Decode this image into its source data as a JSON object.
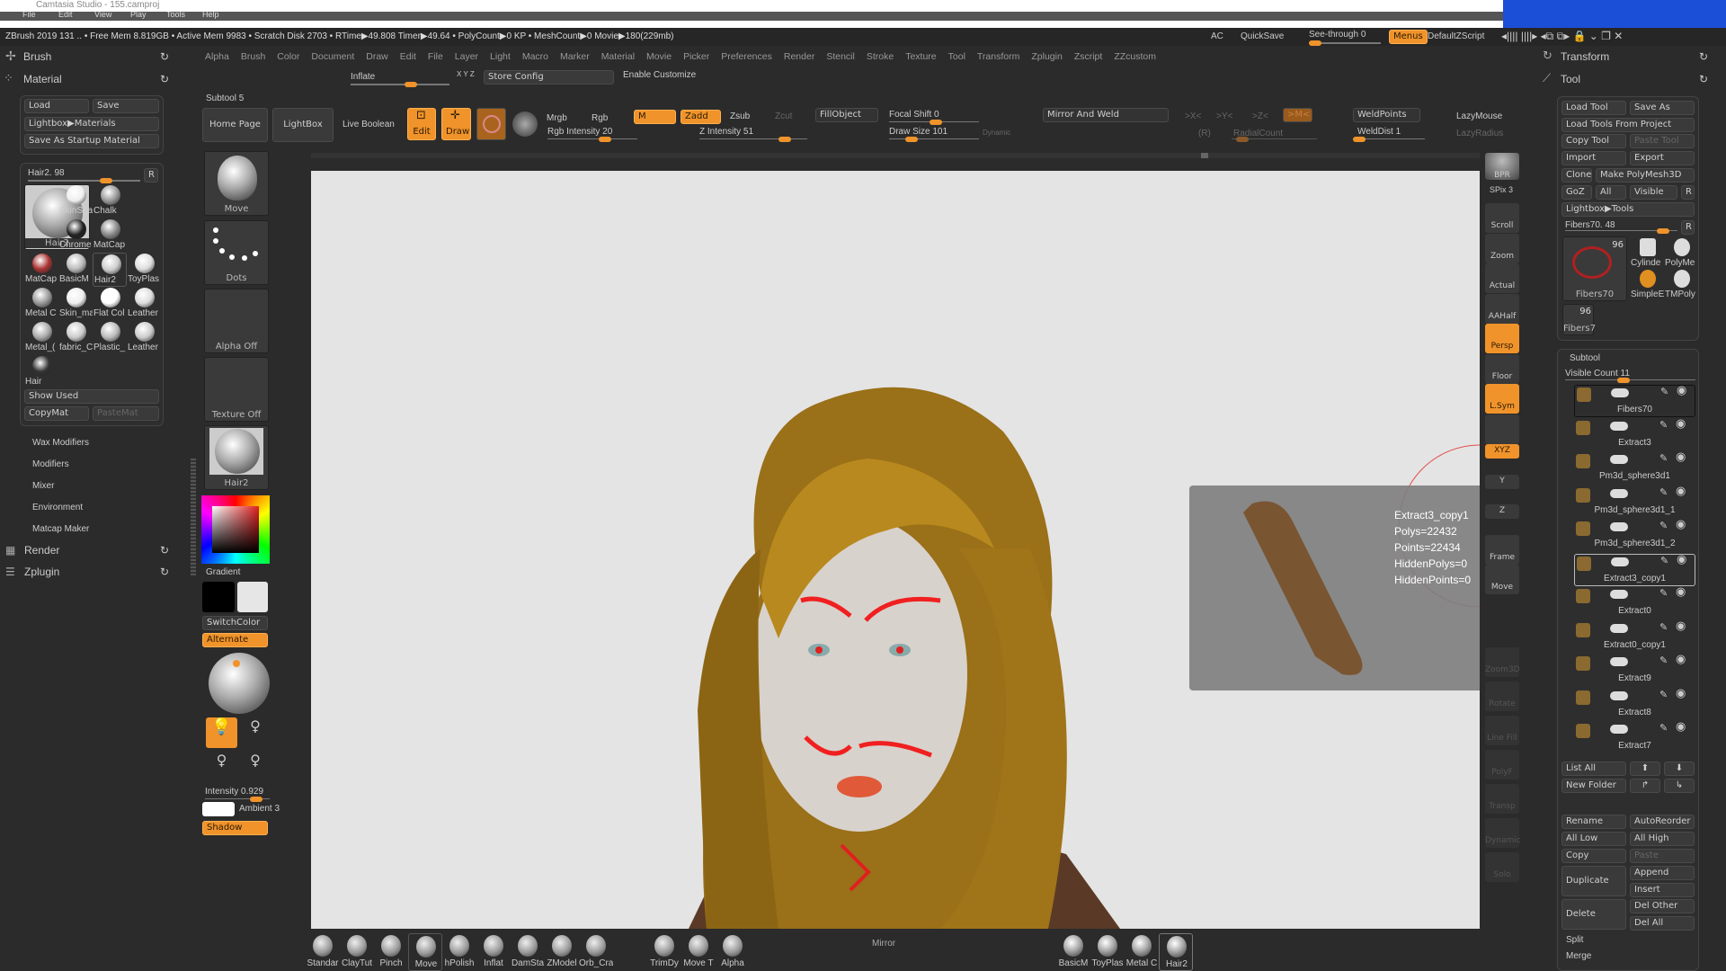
{
  "host": {
    "title": "Camtasia Studio - 155.camproj",
    "menu": [
      "File",
      "Edit",
      "View",
      "Play",
      "Tools",
      "Help"
    ]
  },
  "titlebar": {
    "status": "ZBrush 2019    131   .. • Free Mem 8.819GB • Active Mem 9983 • Scratch Disk 2703 •  RTime▶49.808 Timer▶49.64 • PolyCount▶0 KP  • MeshCount▶0  Movie▶180(229mb)",
    "ac": "AC",
    "quicksave": "QuickSave",
    "see_through": "See-through  0",
    "menus": "Menus",
    "script": "DefaultZScript"
  },
  "menubar": [
    "Alpha",
    "Brush",
    "Color",
    "Document",
    "Draw",
    "Edit",
    "File",
    "Layer",
    "Light",
    "Macro",
    "Marker",
    "Material",
    "Movie",
    "Picker",
    "Preferences",
    "Render",
    "Stencil",
    "Stroke",
    "Texture",
    "Tool",
    "Transform",
    "Zplugin",
    "Zscript",
    "ZZcustom"
  ],
  "custom": {
    "inflate": "Inflate",
    "xyz": "X Y Z",
    "store_config": "Store Config",
    "enable_customize": "Enable Customize"
  },
  "left": {
    "brush": "Brush",
    "material": "Material",
    "load": "Load",
    "save": "Save",
    "lightbox_materials": "Lightbox▶Materials",
    "save_startup": "Save As Startup Material",
    "slider": "Hair2. 98",
    "r": "R",
    "big": "Hair2",
    "materials": [
      "SkinSha",
      "Chalk",
      "Chrome",
      "MatCap",
      "MatCap",
      "BasicM",
      "Hair2",
      "ToyPlas",
      "Metal C",
      "Skin_ma",
      "Flat Col",
      "Leather",
      "Metal_(",
      "fabric_C",
      "Plastic_",
      "Leather",
      "Hair"
    ],
    "show_used": "Show Used",
    "copymat": "CopyMat",
    "pastemat": "PasteMat",
    "submenus": [
      "Wax Modifiers",
      "Modifiers",
      "Mixer",
      "Environment",
      "Matcap Maker"
    ],
    "render": "Render",
    "zplugin": "Zplugin"
  },
  "shelf_left": {
    "move": "Move",
    "dots": "Dots",
    "alpha": "Alpha Off",
    "texture": "Texture Off",
    "material": "Hair2",
    "gradient": "Gradient",
    "switchcolor": "SwitchColor",
    "alternate": "Alternate",
    "intensity": "Intensity 0.929",
    "ambient": "Ambient 3",
    "shadow": "Shadow",
    "main_color": "#000000",
    "secondary_color": "#e6e6e6"
  },
  "toolbar": {
    "subtool": "Subtool 5",
    "home": "Home Page",
    "lightbox": "LightBox",
    "live_boolean": "Live Boolean",
    "edit": "Edit",
    "draw": "Draw",
    "mrgb": "Mrgb",
    "rgb": "Rgb",
    "m": "M",
    "zadd": "Zadd",
    "zsub": "Zsub",
    "zcut": "Zcut",
    "rgb_intensity": "Rgb Intensity 20",
    "z_intensity": "Z Intensity 51",
    "fillobject": "FillObject",
    "focal_shift": "Focal Shift 0",
    "draw_size": "Draw Size 101",
    "dynamic": "Dynamic",
    "mirror_weld": "Mirror And Weld",
    "x": ">X<",
    "y": ">Y<",
    "z": ">Z<",
    "m2": ">M<",
    "r": "(R)",
    "radialcount": "RadialCount",
    "weldpoints": "WeldPoints",
    "welddist": "WeldDist 1",
    "lazymouse": "LazyMouse",
    "lazyradius": "LazyRadius"
  },
  "shelf_right": {
    "bpr": "BPR",
    "spix": "SPix 3",
    "items": [
      "Scroll",
      "Zoom",
      "Actual",
      "AAHalf",
      "Persp",
      "Floor",
      "L.Sym",
      "",
      "XYZ",
      "Y",
      "Z",
      "Frame",
      "Move",
      "Zoom3D",
      "Rotate",
      "Line Fill",
      "PolyF",
      "Transp",
      "Dynamic",
      "Solo"
    ],
    "active": [
      "Persp",
      "L.Sym",
      "XYZ"
    ]
  },
  "info": {
    "name": "Extract3_copy1",
    "polys": "Polys=22432",
    "points": "Points=22434",
    "hidden_polys": "HiddenPolys=0",
    "hidden_points": "HiddenPoints=0"
  },
  "right": {
    "transform": "Transform",
    "tool": "Tool",
    "load_tool": "Load Tool",
    "save_as": "Save As",
    "load_project": "Load Tools From Project",
    "copy_tool": "Copy Tool",
    "paste_tool": "Paste Tool",
    "import": "Import",
    "export": "Export",
    "clone": "Clone",
    "make_polymesh": "Make PolyMesh3D",
    "goz": "GoZ",
    "all": "All",
    "visible": "Visible",
    "r": "R",
    "lightbox_tools": "Lightbox▶Tools",
    "slider": "Fibers70. 48",
    "big": "Fibers70",
    "big_count": "96",
    "tools": [
      "Cylinde",
      "PolyMe",
      "SimpleE",
      "TMPoly"
    ],
    "small": "Fibers7",
    "small_count": "96",
    "subtool": "Subtool",
    "visible_count": "Visible Count 11",
    "subtools": [
      "Fibers70",
      "Extract3",
      "Pm3d_sphere3d1",
      "Pm3d_sphere3d1_1",
      "Pm3d_sphere3d1_2",
      "Extract3_copy1",
      "Extract0",
      "Extract0_copy1",
      "Extract9",
      "Extract8",
      "Extract7"
    ],
    "selected_subtool": "Extract3_copy1",
    "list_all": "List All",
    "new_folder": "New Folder",
    "rename": "Rename",
    "autoreorder": "AutoReorder",
    "all_low": "All Low",
    "all_high": "All High",
    "copy": "Copy",
    "paste": "Paste",
    "duplicate": "Duplicate",
    "append": "Append",
    "insert": "Insert",
    "delete": "Delete",
    "del_other": "Del Other",
    "del_all": "Del All",
    "split": "Split",
    "merge": "Merge"
  },
  "bottom": {
    "brushes": [
      "Standar",
      "ClayTut",
      "Pinch",
      "Move",
      "hPolish",
      "Inflat",
      "DamSta",
      "ZModel",
      "Orb_Cra",
      "TrimDy",
      "Move T",
      "Alpha"
    ],
    "mirror": "Mirror",
    "materials": [
      "BasicM",
      "ToyPlas",
      "Metal C",
      "Hair2"
    ]
  },
  "colors": {
    "accent": "#f0932a",
    "panel": "#2b2b2b",
    "canvas": "#e4e4e4"
  }
}
